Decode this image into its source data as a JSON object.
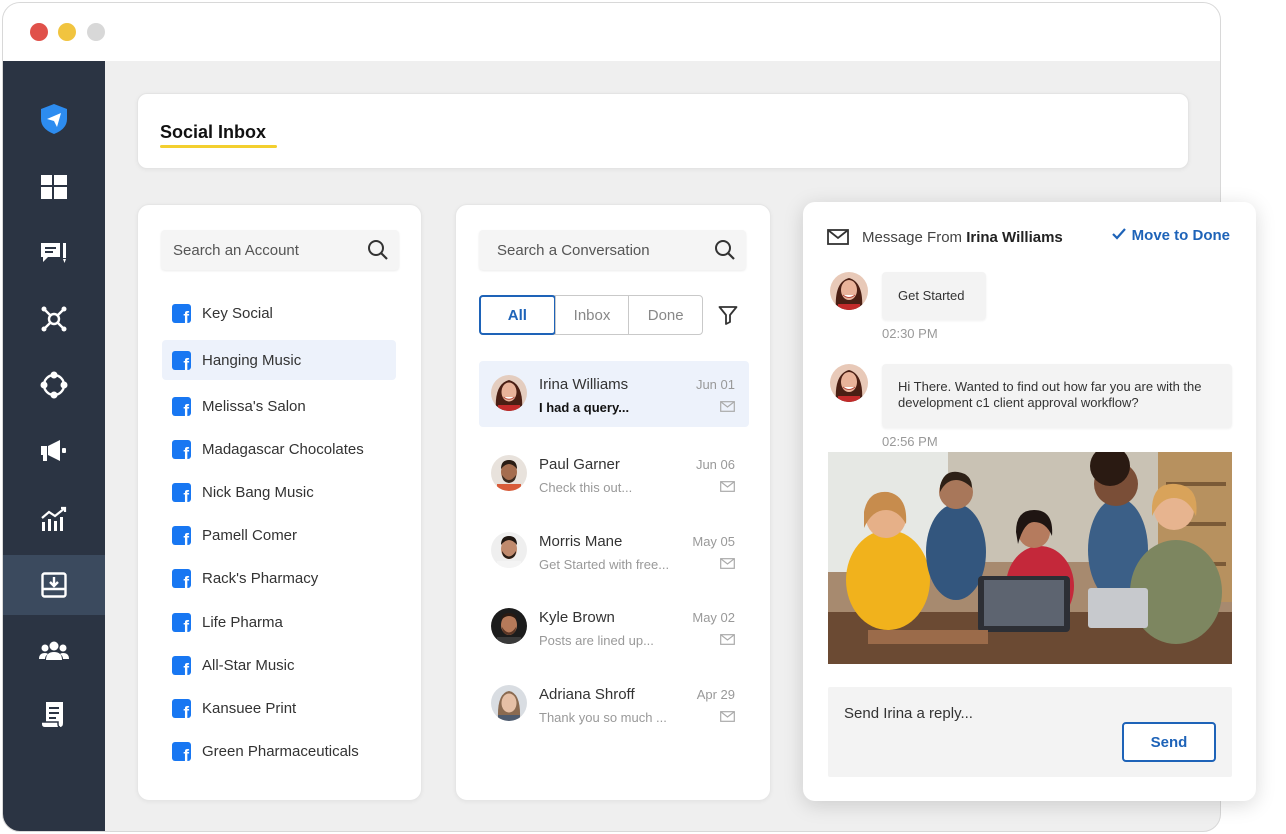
{
  "page": {
    "title": "Social Inbox"
  },
  "sidebar": {
    "items": [
      {
        "icon": "send-logo-icon",
        "active": false
      },
      {
        "icon": "dashboard-icon",
        "active": false
      },
      {
        "icon": "posts-icon",
        "active": false
      },
      {
        "icon": "network-icon",
        "active": false
      },
      {
        "icon": "integrations-icon",
        "active": false
      },
      {
        "icon": "megaphone-icon",
        "active": false
      },
      {
        "icon": "analytics-icon",
        "active": false
      },
      {
        "icon": "inbox-icon",
        "active": true
      },
      {
        "icon": "team-icon",
        "active": false
      },
      {
        "icon": "reports-icon",
        "active": false
      }
    ]
  },
  "accounts": {
    "search_placeholder": "Search an Account",
    "items": [
      {
        "label": "Key Social",
        "selected": false
      },
      {
        "label": "Hanging Music",
        "selected": true
      },
      {
        "label": "Melissa's Salon",
        "selected": false
      },
      {
        "label": "Madagascar Chocolates",
        "selected": false
      },
      {
        "label": "Nick Bang Music",
        "selected": false
      },
      {
        "label": "Pamell Comer",
        "selected": false
      },
      {
        "label": "Rack's Pharmacy",
        "selected": false
      },
      {
        "label": "Life Pharma",
        "selected": false
      },
      {
        "label": "All-Star Music",
        "selected": false
      },
      {
        "label": "Kansuee Print",
        "selected": false
      },
      {
        "label": "Green Pharmaceuticals",
        "selected": false
      }
    ]
  },
  "conversations": {
    "search_placeholder": "Search a Conversation",
    "tabs": [
      {
        "label": "All",
        "active": true
      },
      {
        "label": "Inbox",
        "active": false
      },
      {
        "label": "Done",
        "active": false
      }
    ],
    "items": [
      {
        "name": "Irina Williams",
        "date": "Jun 01",
        "preview": "I had a query...",
        "unread": true,
        "selected": true
      },
      {
        "name": "Paul Garner",
        "date": "Jun 06",
        "preview": "Check this out...",
        "unread": false,
        "selected": false
      },
      {
        "name": "Morris Mane",
        "date": "May 05",
        "preview": "Get Started with free...",
        "unread": false,
        "selected": false
      },
      {
        "name": "Kyle Brown",
        "date": "May 02",
        "preview": "Posts are lined up...",
        "unread": false,
        "selected": false
      },
      {
        "name": "Adriana Shroff",
        "date": "Apr 29",
        "preview": "Thank you so much ...",
        "unread": false,
        "selected": false
      }
    ]
  },
  "message": {
    "header_prefix": "Message From",
    "sender": "Irina Williams",
    "move_done_label": "Move to Done",
    "messages": [
      {
        "text": "Get Started",
        "time": "02:30 PM"
      },
      {
        "text": "Hi There. Wanted to find out how far you are with the development c1 client approval workflow?",
        "time": "02:56 PM"
      }
    ],
    "reply_placeholder": "Send Irina a reply...",
    "send_label": "Send"
  },
  "colors": {
    "accent": "#1e63b8",
    "sidebar": "#2b3443",
    "sidebar_active": "#3b4a5e",
    "title_underline": "#f3cf2f",
    "facebook": "#1877f2"
  }
}
